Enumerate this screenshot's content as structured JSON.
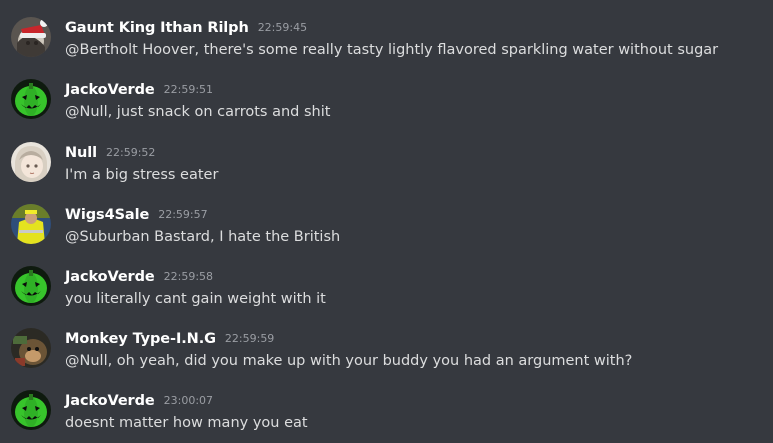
{
  "messages": [
    {
      "author": "Gaunt King Ithan Rilph",
      "time": "22:59:45",
      "text": "@Bertholt Hoover, there's some really tasty lightly flavored sparkling water without sugar",
      "avatar": "santa-hat-avatar"
    },
    {
      "author": "JackoVerde",
      "time": "22:59:51",
      "text": "@Null, just snack on carrots and shit",
      "avatar": "green-pumpkin-avatar"
    },
    {
      "author": "Null",
      "time": "22:59:52",
      "text": "I'm a big stress eater",
      "avatar": "anime-avatar"
    },
    {
      "author": "Wigs4Sale",
      "time": "22:59:57",
      "text": "@Suburban Bastard, I hate the British",
      "avatar": "yellow-vest-avatar"
    },
    {
      "author": "JackoVerde",
      "time": "22:59:58",
      "text": "you literally cant gain weight with it",
      "avatar": "green-pumpkin-avatar"
    },
    {
      "author": "Monkey Type-I.N.G",
      "time": "22:59:59",
      "text": "@Null, oh yeah, did you make up with your buddy you had an argument with?",
      "avatar": "monkey-avatar"
    },
    {
      "author": "JackoVerde",
      "time": "23:00:07",
      "text": "doesnt matter how many you eat",
      "avatar": "green-pumpkin-avatar"
    }
  ],
  "colors": {
    "background": "#36393f",
    "author": "#ffffff",
    "timestamp": "#9a9da3",
    "text": "#dcddde",
    "pumpkin": "#37c42b"
  }
}
